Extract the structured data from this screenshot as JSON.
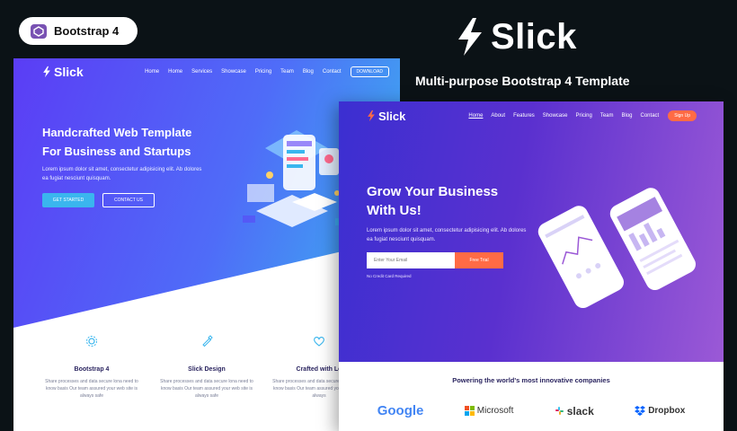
{
  "badge": {
    "label": "Bootstrap 4"
  },
  "brand": {
    "name": "Slick",
    "tagline": "Multi-purpose Bootstrap 4 Template"
  },
  "left_shot": {
    "logo": "Slick",
    "menu": [
      "Home",
      "Home",
      "Services",
      "Showcase",
      "Pricing",
      "Team",
      "Blog",
      "Contact"
    ],
    "download_button": "DOWNLOAD",
    "heading_line1": "Handcrafted Web Template",
    "heading_line2": "For Business and Startups",
    "paragraph": "Lorem ipsum dolor sit amet, consectetur adipisicing elit. Ab dolores ea fugiat nesciunt quisquam.",
    "primary_button": "GET STARTED",
    "secondary_button": "CONTACT US",
    "features": [
      {
        "title": "Bootstrap 4",
        "text": "Share processes and data secure lona need to know basis Our team assured your web site is always safe"
      },
      {
        "title": "Slick Design",
        "text": "Share processes and data secure lona need to know basis Our team assured your web site is always safe"
      },
      {
        "title": "Crafted with Lo",
        "text": "Share processes and data secure lona need to know basis Our team assured your web site is always"
      }
    ]
  },
  "right_shot": {
    "logo": "Slick",
    "menu": [
      "Home",
      "About",
      "Features",
      "Showcase",
      "Pricing",
      "Team",
      "Blog",
      "Contact"
    ],
    "sign_up": "Sign Up",
    "heading_line1": "Grow Your Business",
    "heading_line2": "With Us!",
    "paragraph": "Lorem ipsum dolor sit amet, consectetur adipisicing elit. Ab dolores ea fugiat nesciunt quisquam.",
    "email_placeholder": "Enter Your Email",
    "submit_button": "Free Trial",
    "note": "No Credit Card Required",
    "powering": "Powering the world's most innovative companies",
    "companies": [
      "Google",
      "Microsoft",
      "slack",
      "Dropbox"
    ]
  },
  "colors": {
    "bg": "#0b1216",
    "left_gradient_start": "#5b3df5",
    "left_gradient_end": "#3ab6ee",
    "right_gradient_start": "#3b2fd1",
    "right_gradient_end": "#9b59d6",
    "accent_orange": "#ff6b45"
  }
}
